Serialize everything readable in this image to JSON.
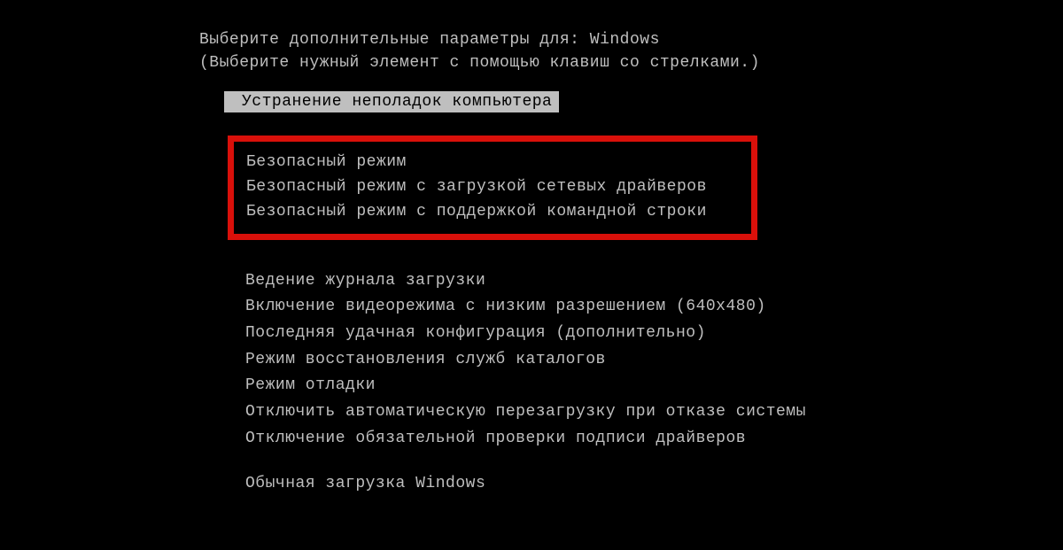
{
  "header": {
    "prompt_label": "Выберите дополнительные параметры для:",
    "os_name": "Windows",
    "help_text": "(Выберите нужный элемент с помощью клавиш со стрелками.)"
  },
  "selected_option": "Устранение неполадок компьютера",
  "safe_mode_group": [
    "Безопасный режим",
    "Безопасный режим с загрузкой сетевых драйверов",
    "Безопасный режим с поддержкой командной строки"
  ],
  "other_options_block1": [
    "Ведение журнала загрузки",
    "Включение видеорежима с низким разрешением (640x480)",
    "Последняя удачная конфигурация (дополнительно)",
    "Режим восстановления служб каталогов",
    "Режим отладки",
    "Отключить автоматическую перезагрузку при отказе системы",
    "Отключение обязательной проверки подписи драйверов"
  ],
  "other_options_block2": [
    "Обычная загрузка Windows"
  ]
}
